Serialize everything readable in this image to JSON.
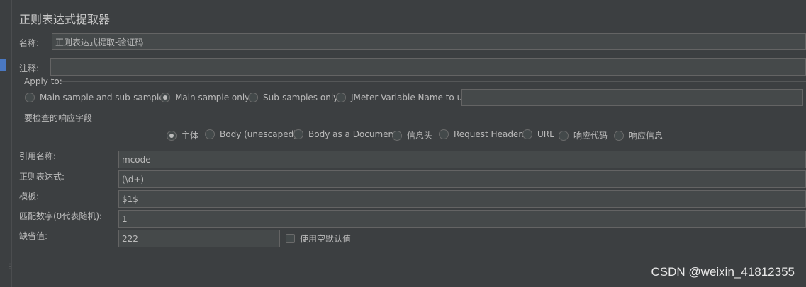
{
  "title": "正则表达式提取器",
  "name": {
    "label": "名称:",
    "value": "正则表达式提取-验证码"
  },
  "comment": {
    "label": "注释:",
    "value": ""
  },
  "apply_to": {
    "title": "Apply to:",
    "options": [
      {
        "label": "Main sample and sub-samples",
        "selected": false
      },
      {
        "label": "Main sample only",
        "selected": true
      },
      {
        "label": "Sub-samples only",
        "selected": false
      },
      {
        "label": "JMeter Variable Name to use",
        "selected": false
      }
    ],
    "variable_value": ""
  },
  "response_field": {
    "title": "要检查的响应字段",
    "options": [
      {
        "label": "主体",
        "selected": true
      },
      {
        "label": "Body (unescaped)",
        "selected": false
      },
      {
        "label": "Body as a Document",
        "selected": false
      },
      {
        "label": "信息头",
        "selected": false
      },
      {
        "label": "Request Headers",
        "selected": false
      },
      {
        "label": "URL",
        "selected": false
      },
      {
        "label": "响应代码",
        "selected": false
      },
      {
        "label": "响应信息",
        "selected": false
      }
    ]
  },
  "fields": {
    "reference_name": {
      "label": "引用名称:",
      "value": "mcode"
    },
    "regex": {
      "label": "正则表达式:",
      "value": "(\\d+)"
    },
    "template": {
      "label": "模板:",
      "value": "$1$"
    },
    "match_no": {
      "label": "匹配数字(0代表随机):",
      "value": "1"
    },
    "default_value": {
      "label": "缺省值:",
      "value": "222"
    }
  },
  "use_empty_default": {
    "label": "使用空默认值",
    "checked": false
  },
  "watermark": "CSDN @weixin_41812355"
}
